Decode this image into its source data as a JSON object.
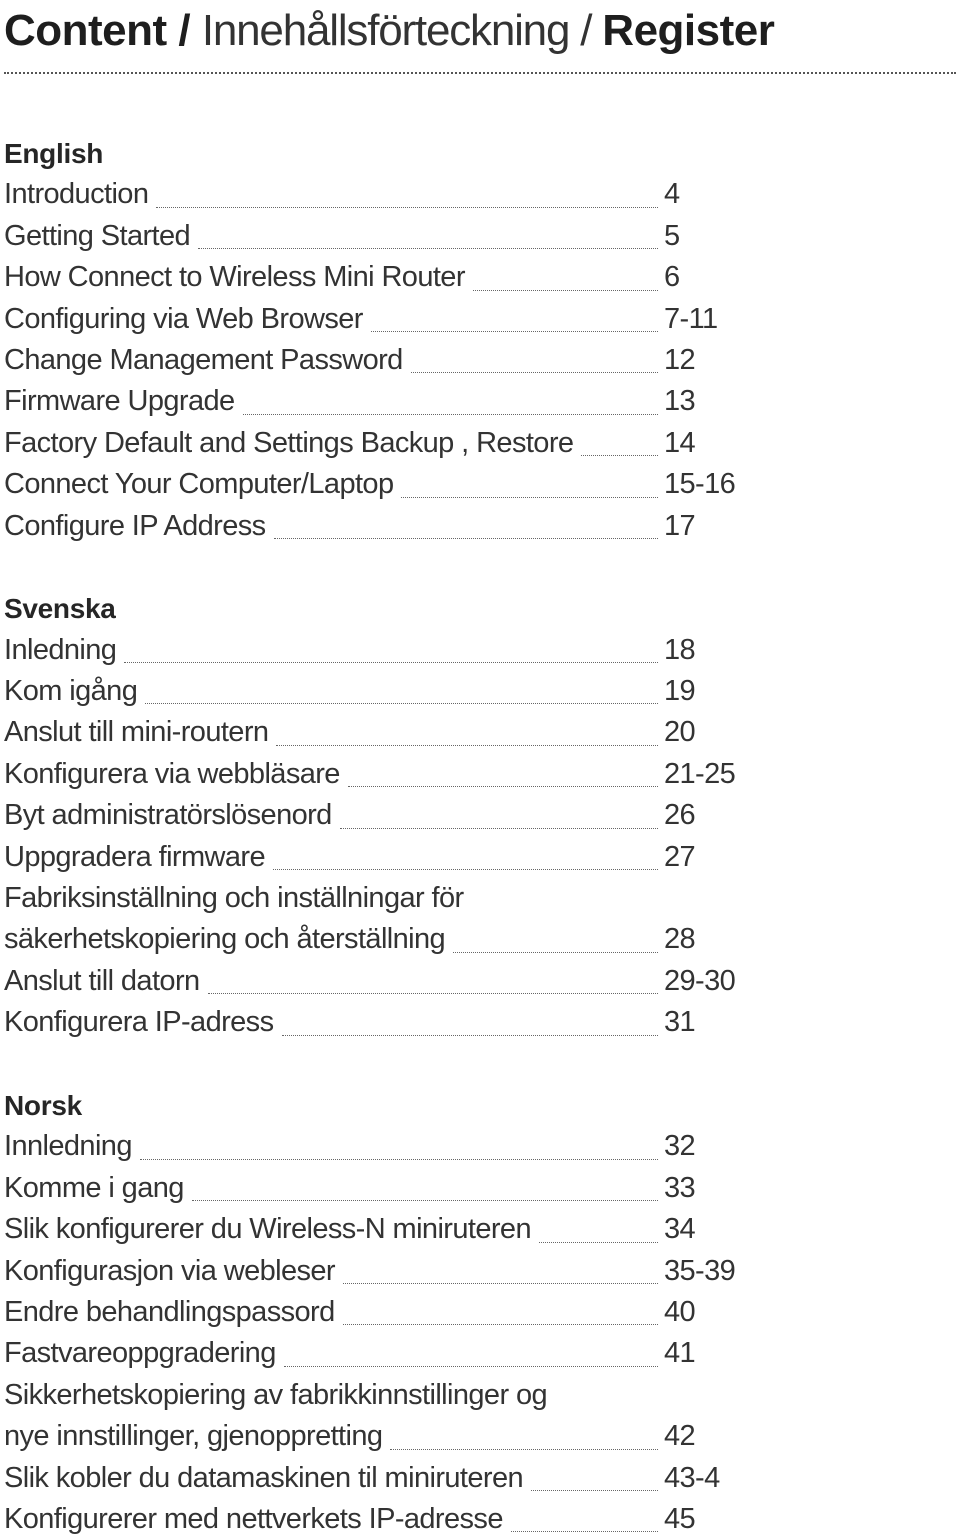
{
  "title": {
    "part1": "Content / ",
    "part2": "Innehållsförteckning / ",
    "part3": "Register"
  },
  "sections": [
    {
      "heading": "English",
      "entries": [
        {
          "label": "Introduction",
          "page": "4"
        },
        {
          "label": "Getting Started",
          "page": "5"
        },
        {
          "label": "How Connect to Wireless Mini Router",
          "page": "6"
        },
        {
          "label": "Configuring via Web Browser",
          "page": "7-11"
        },
        {
          "label": "Change Management Password",
          "page": "12"
        },
        {
          "label": "Firmware Upgrade",
          "page": "13"
        },
        {
          "label": "Factory Default and Settings Backup , Restore",
          "page": "14"
        },
        {
          "label": "Connect Your Computer/Laptop",
          "page": "15-16"
        },
        {
          "label": "Configure IP Address",
          "page": "17"
        }
      ]
    },
    {
      "heading": "Svenska",
      "entries": [
        {
          "label": "Inledning",
          "page": "18"
        },
        {
          "label": "Kom igång",
          "page": "19"
        },
        {
          "label": "Anslut till mini-routern",
          "page": "20"
        },
        {
          "label": "Konfigurera via webbläsare",
          "page": "21-25"
        },
        {
          "label": "Byt administratörslösenord",
          "page": "26"
        },
        {
          "label": "Uppgradera firmware",
          "page": "27"
        },
        {
          "label_line1": "Fabriksinställning och inställningar för",
          "label": "säkerhetskopiering och återställning",
          "page": "28"
        },
        {
          "label": "Anslut till datorn",
          "page": "29-30"
        },
        {
          "label": "Konfigurera IP-adress",
          "page": "31"
        }
      ]
    },
    {
      "heading": "Norsk",
      "entries": [
        {
          "label": "Innledning",
          "page": "32"
        },
        {
          "label": "Komme i gang",
          "page": "33"
        },
        {
          "label": "Slik konfigurerer du Wireless-N miniruteren",
          "page": "34"
        },
        {
          "label": "Konfigurasjon via webleser",
          "page": "35-39"
        },
        {
          "label": "Endre behandlingspassord",
          "page": "40"
        },
        {
          "label": "Fastvareoppgradering",
          "page": "41"
        },
        {
          "label_line1": "Sikkerhetskopiering av fabrikkinnstillinger og",
          "label": "nye innstillinger, gjenoppretting",
          "page": "42"
        },
        {
          "label": "Slik kobler du datamaskinen til miniruteren",
          "page": "43-4"
        },
        {
          "label": "Konfigurerer med nettverkets IP-adresse",
          "page": "45"
        }
      ]
    }
  ]
}
